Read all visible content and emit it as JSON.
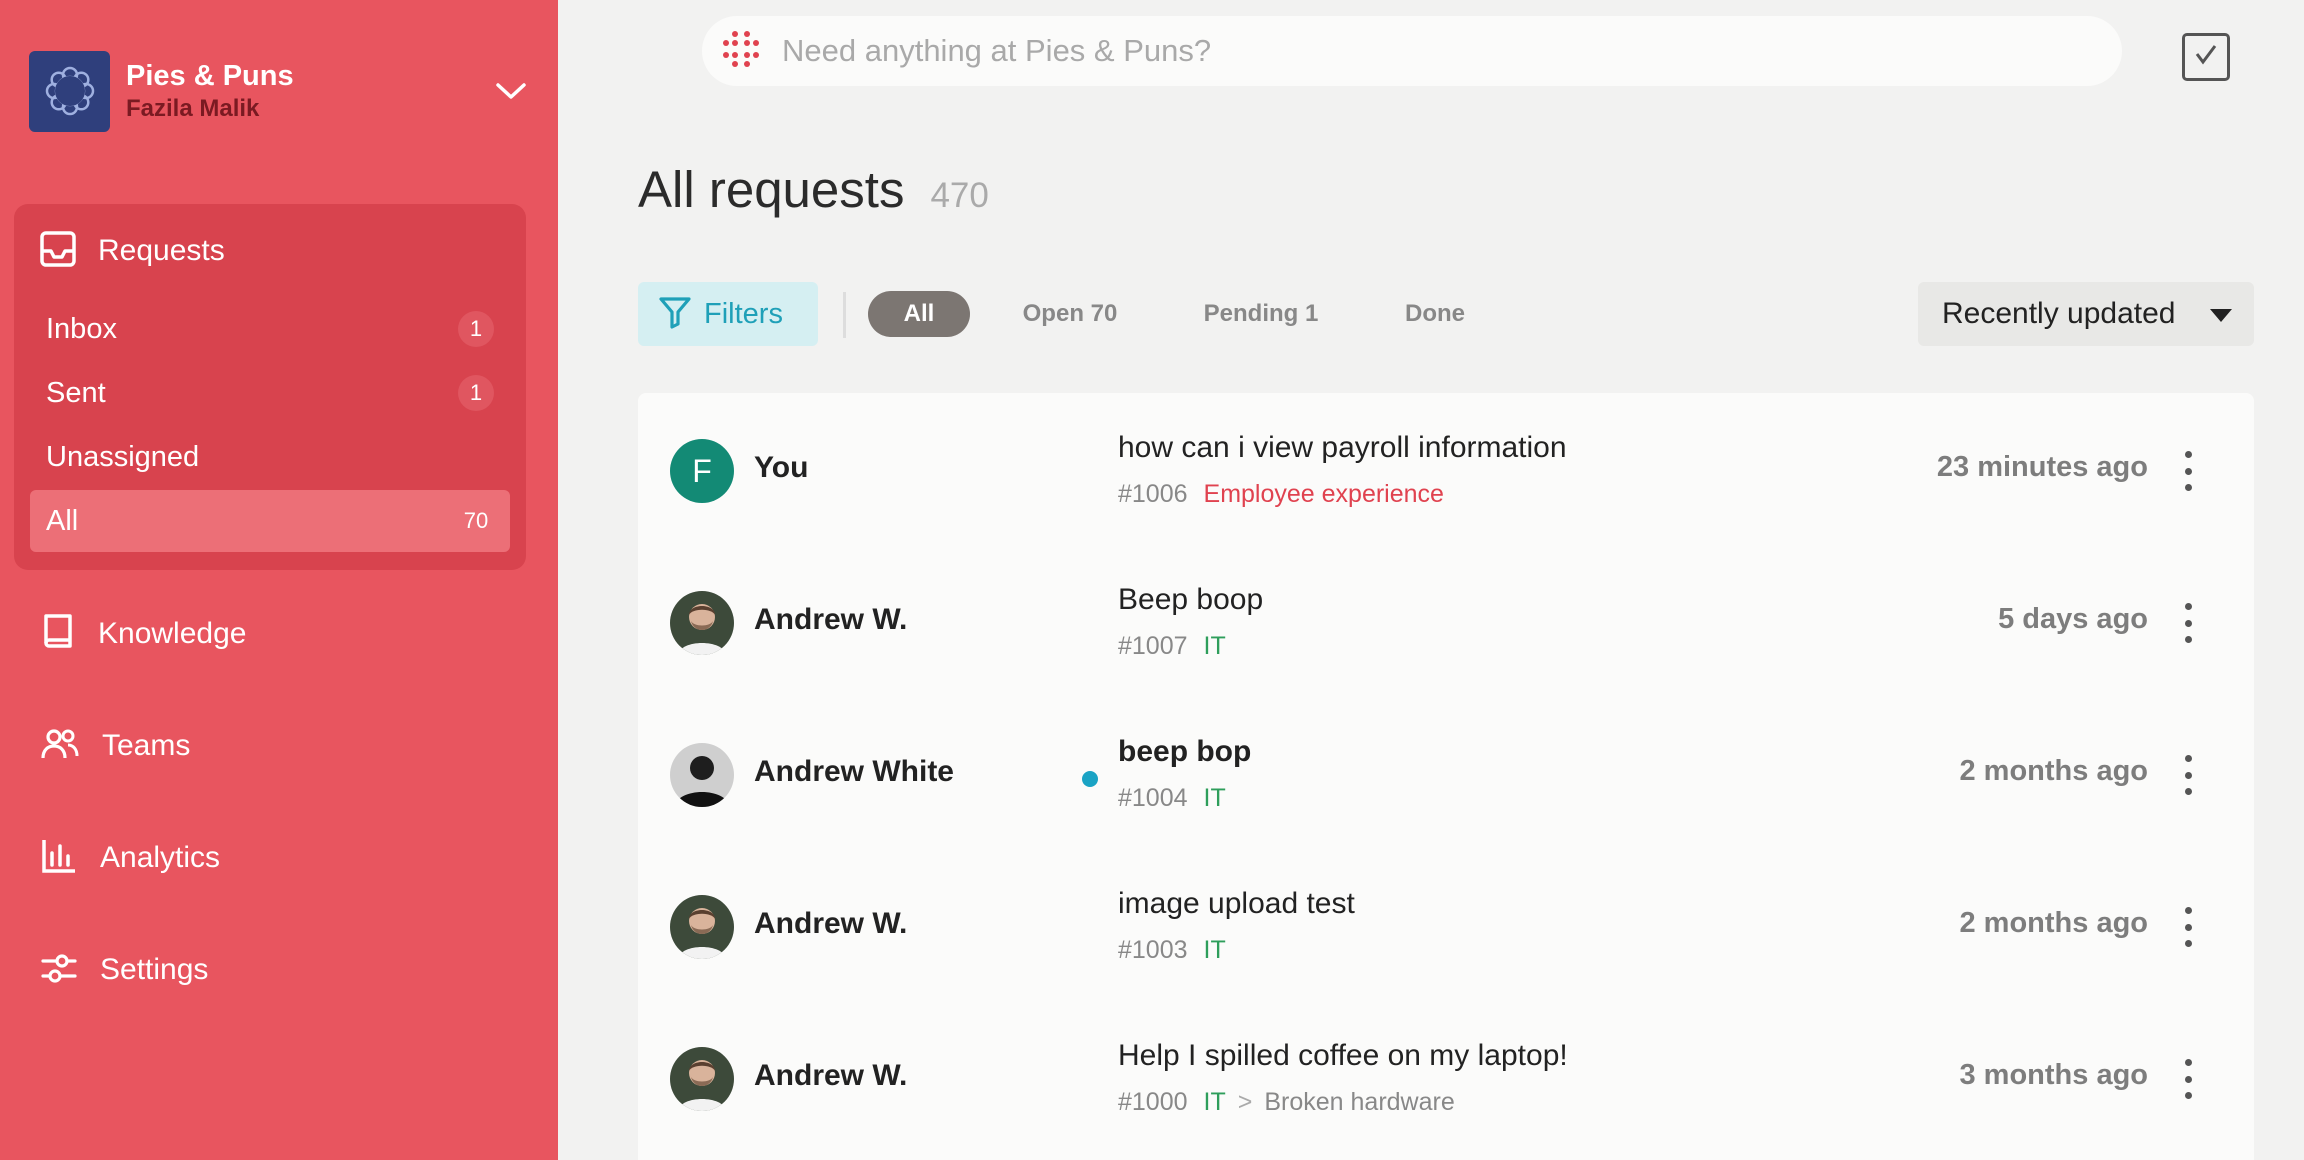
{
  "org": {
    "name": "Pies & Puns",
    "user": "Fazila Malik"
  },
  "nav": {
    "requests_label": "Requests",
    "sub_items": [
      {
        "label": "Inbox",
        "count": "1"
      },
      {
        "label": "Sent",
        "count": "1"
      },
      {
        "label": "Unassigned",
        "count": ""
      },
      {
        "label": "All",
        "count": "70"
      }
    ],
    "knowledge": "Knowledge",
    "teams": "Teams",
    "analytics": "Analytics",
    "settings": "Settings"
  },
  "search": {
    "placeholder": "Need anything at Pies & Puns?"
  },
  "page": {
    "title": "All requests",
    "count": "470"
  },
  "toolbar": {
    "filters_label": "Filters",
    "segments": [
      "All",
      "Open 70",
      "Pending 1",
      "Done"
    ],
    "active_segment": "All",
    "sort_label": "Recently updated"
  },
  "requests": [
    {
      "requester": "You",
      "avatar_letter": "F",
      "subject": "how can i view payroll information",
      "id": "#1006",
      "category": "Employee experience",
      "category_color": "#e0424f",
      "subcategory": "",
      "time": "23 minutes ago",
      "unread": false
    },
    {
      "requester": "Andrew W.",
      "avatar_letter": "",
      "subject": "Beep boop",
      "id": "#1007",
      "category": "IT",
      "category_color": "#2e9e5b",
      "subcategory": "",
      "time": "5 days ago",
      "unread": false
    },
    {
      "requester": "Andrew White",
      "avatar_letter": "",
      "subject": "beep bop",
      "id": "#1004",
      "category": "IT",
      "category_color": "#2e9e5b",
      "subcategory": "",
      "time": "2 months ago",
      "unread": true
    },
    {
      "requester": "Andrew W.",
      "avatar_letter": "",
      "subject": "image upload test",
      "id": "#1003",
      "category": "IT",
      "category_color": "#2e9e5b",
      "subcategory": "",
      "time": "2 months ago",
      "unread": false
    },
    {
      "requester": "Andrew W.",
      "avatar_letter": "",
      "subject": "Help I spilled coffee on my laptop!",
      "id": "#1000",
      "category": "IT",
      "category_color": "#2e9e5b",
      "subcategory": "Broken hardware",
      "time": "3 months ago",
      "unread": false
    }
  ],
  "colors": {
    "sidebar": "#e8555f",
    "accent_teal": "#1fa0b8",
    "unread_dot": "#1aa3c4"
  }
}
